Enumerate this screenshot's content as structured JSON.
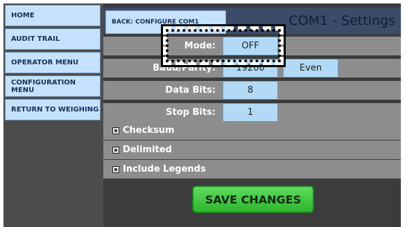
{
  "sidebar": {
    "items": [
      {
        "label": "HOME"
      },
      {
        "label": "AUDIT TRAIL"
      },
      {
        "label": "OPERATOR MENU"
      },
      {
        "label": "CONFIGURATION MENU"
      },
      {
        "label": "RETURN TO WEIGHING"
      }
    ]
  },
  "header": {
    "back_label": "BACK: CONFIGURE COM1",
    "title": "COM1 - Settings"
  },
  "settings": {
    "mode": {
      "label": "Mode:",
      "value": "OFF"
    },
    "baud": {
      "label": "Baud/Parity:",
      "value": "19200",
      "parity": "Even"
    },
    "data_bits": {
      "label": "Data Bits:",
      "value": "8"
    },
    "stop_bits": {
      "label": "Stop Bits:",
      "value": "1"
    }
  },
  "options": {
    "checksum": "Checksum",
    "delimited": "Delimited",
    "include_legends": "Include Legends"
  },
  "actions": {
    "save_label": "SAVE CHANGES"
  },
  "colors": {
    "nav_button": "#c4e2ff",
    "value_box": "#b2daf7",
    "row_bg": "#8d8d8d",
    "save_button": "#3cc43c"
  }
}
